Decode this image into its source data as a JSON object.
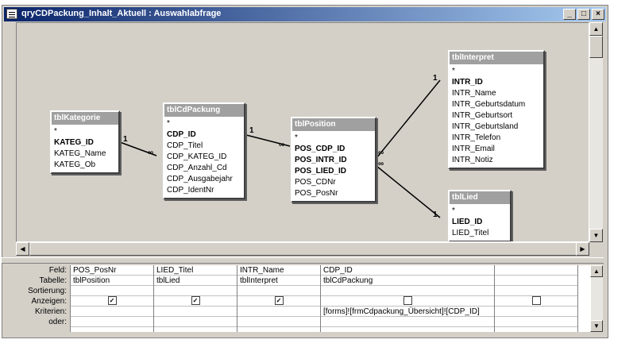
{
  "window": {
    "title": "qryCDPackung_Inhalt_Aktuell : Auswahlabfrage"
  },
  "controls": {
    "minimize": "_",
    "maximize": "□",
    "close": "×"
  },
  "tables": {
    "kategorie": {
      "name": "tblKategorie",
      "fields": [
        {
          "label": "*",
          "pk": false
        },
        {
          "label": "KATEG_ID",
          "pk": true
        },
        {
          "label": "KATEG_Name",
          "pk": false
        },
        {
          "label": "KATEG_Ob",
          "pk": false
        }
      ]
    },
    "cdpackung": {
      "name": "tblCdPackung",
      "fields": [
        {
          "label": "*",
          "pk": false
        },
        {
          "label": "CDP_ID",
          "pk": true
        },
        {
          "label": "CDP_Titel",
          "pk": false
        },
        {
          "label": "CDP_KATEG_ID",
          "pk": false
        },
        {
          "label": "CDP_Anzahl_Cd",
          "pk": false
        },
        {
          "label": "CDP_Ausgabejahr",
          "pk": false
        },
        {
          "label": "CDP_IdentNr",
          "pk": false
        }
      ]
    },
    "position": {
      "name": "tblPosition",
      "fields": [
        {
          "label": "*",
          "pk": false
        },
        {
          "label": "POS_CDP_ID",
          "pk": true
        },
        {
          "label": "POS_INTR_ID",
          "pk": true
        },
        {
          "label": "POS_LIED_ID",
          "pk": true
        },
        {
          "label": "POS_CDNr",
          "pk": false
        },
        {
          "label": "POS_PosNr",
          "pk": false
        }
      ]
    },
    "interpret": {
      "name": "tblInterpret",
      "fields": [
        {
          "label": "*",
          "pk": false
        },
        {
          "label": "INTR_ID",
          "pk": true
        },
        {
          "label": "INTR_Name",
          "pk": false
        },
        {
          "label": "INTR_Geburtsdatum",
          "pk": false
        },
        {
          "label": "INTR_Geburtsort",
          "pk": false
        },
        {
          "label": "INTR_Geburtsland",
          "pk": false
        },
        {
          "label": "INTR_Telefon",
          "pk": false
        },
        {
          "label": "INTR_Email",
          "pk": false
        },
        {
          "label": "INTR_Notiz",
          "pk": false
        }
      ]
    },
    "lied": {
      "name": "tblLied",
      "fields": [
        {
          "label": "*",
          "pk": false
        },
        {
          "label": "LIED_ID",
          "pk": true
        },
        {
          "label": "LIED_Titel",
          "pk": false
        }
      ]
    }
  },
  "relation_labels": {
    "one": "1",
    "many": "∞"
  },
  "grid": {
    "row_labels": [
      "Feld:",
      "Tabelle:",
      "Sortierung:",
      "Anzeigen:",
      "Kriterien:",
      "oder:"
    ],
    "columns": [
      {
        "feld": "POS_PosNr",
        "tabelle": "tblPosition",
        "sortierung": "",
        "anzeigen": true,
        "kriterien": "",
        "oder": ""
      },
      {
        "feld": "LIED_Titel",
        "tabelle": "tblLied",
        "sortierung": "",
        "anzeigen": true,
        "kriterien": "",
        "oder": ""
      },
      {
        "feld": "INTR_Name",
        "tabelle": "tblInterpret",
        "sortierung": "",
        "anzeigen": true,
        "kriterien": "",
        "oder": ""
      },
      {
        "feld": "CDP_ID",
        "tabelle": "tblCdPackung",
        "sortierung": "",
        "anzeigen": false,
        "kriterien": "[forms]![frmCdpackung_Übersicht]![CDP_ID]",
        "oder": ""
      },
      {
        "feld": "",
        "tabelle": "",
        "sortierung": "",
        "anzeigen": false,
        "kriterien": "",
        "oder": ""
      }
    ]
  }
}
